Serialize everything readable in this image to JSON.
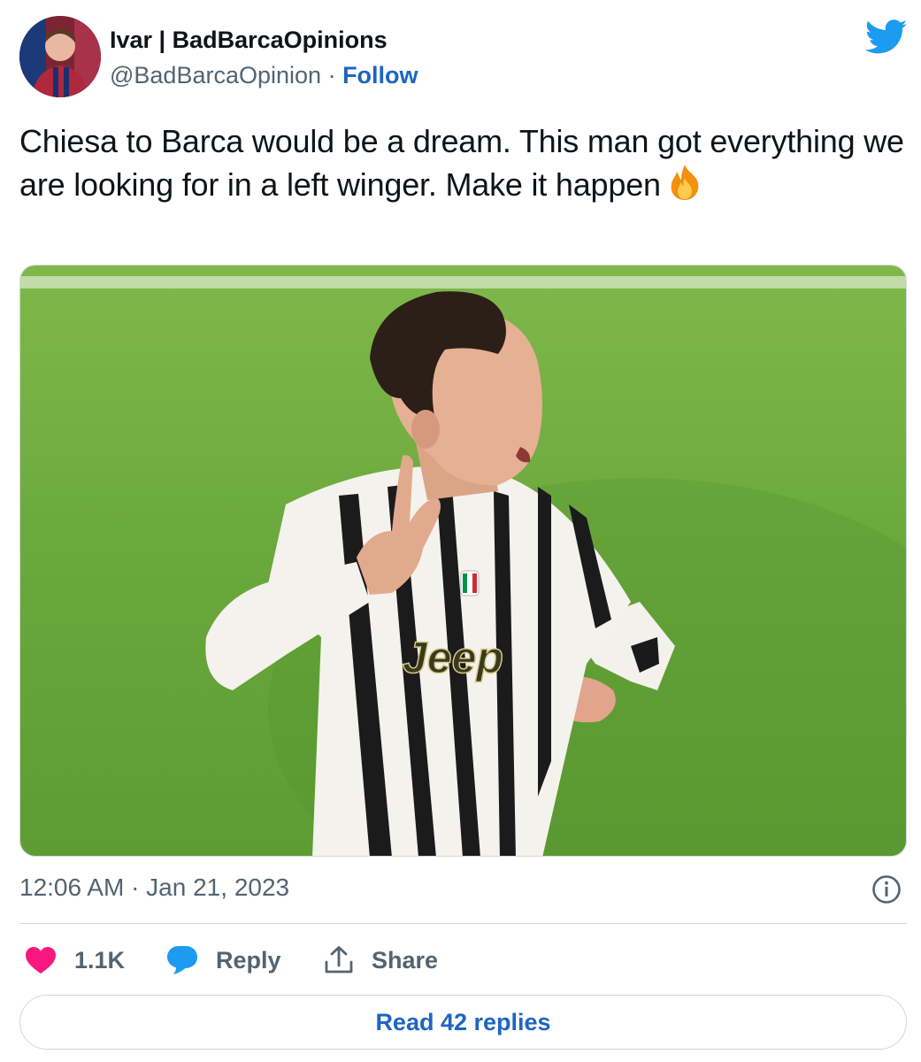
{
  "author": {
    "display_name": "Ivar | BadBarcaOpinions",
    "handle": "@BadBarcaOpinion",
    "separator": "·",
    "follow_label": "Follow"
  },
  "tweet": {
    "text": "Chiesa to Barca would be a dream. This man got everything we are looking for in a left winger. Make it happen",
    "emoji": "fire"
  },
  "media": {
    "jersey_sponsor": "Jeep"
  },
  "meta": {
    "timestamp": "12:06 AM · Jan 21, 2023"
  },
  "actions": {
    "like_count": "1.1K",
    "reply_label": "Reply",
    "share_label": "Share"
  },
  "footer": {
    "read_replies_label": "Read 42 replies"
  },
  "colors": {
    "link_blue": "#1d65c1",
    "twitter_blue": "#1d9bf0",
    "like_pink": "#f91880",
    "secondary_text": "#536471",
    "border": "#cfd9de"
  },
  "icons": [
    "twitter-bird-icon",
    "fire-emoji-icon",
    "info-icon",
    "heart-icon",
    "reply-bubble-icon",
    "share-icon"
  ]
}
